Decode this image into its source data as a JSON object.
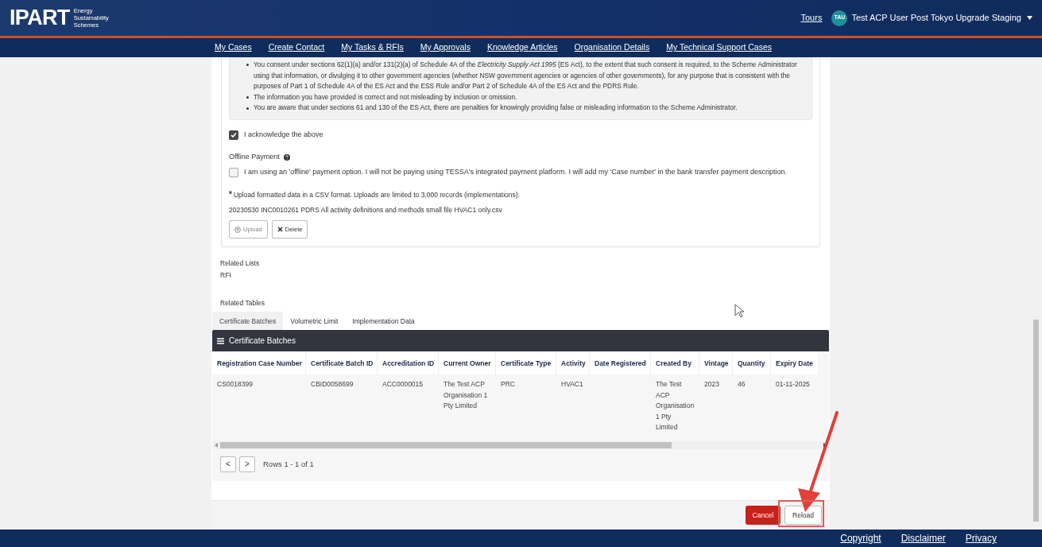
{
  "header": {
    "logo": "IPART",
    "logo_subtitle": [
      "Energy",
      "Sustainability",
      "Schemes"
    ],
    "tours_link": "Tours",
    "user_initials": "TAU",
    "user_name": "Test ACP User Post Tokyo Upgrade Staging"
  },
  "nav": [
    "My Cases",
    "Create Contact",
    "My Tasks & RFIs",
    "My Approvals",
    "Knowledge Articles",
    "Organisation Details",
    "My Technical Support Cases"
  ],
  "declarations": [
    {
      "text": "You consent under sections 62(1)(a) and/or 131(2)(a) of Schedule 4A of the *Electricity Supply Act 1995* (ES Act), to the extent that such consent is required, to the Scheme Administrator using that information, or divulging it to other government agencies (whether NSW government agencies or agencies of other governments), for any purpose that is consistent with the purposes of Part 1 of Schedule 4A of the ES Act and the ESS Rule and/or Part 2 of Schedule 4A of the ES Act and the PDRS Rule."
    },
    {
      "text": "The information you have provided is correct and not misleading by inclusion or omission."
    },
    {
      "text": "You are aware that under sections 61 and 130 of the ES Act, there are penalties for knowingly providing false or misleading information to the Scheme Administrator."
    }
  ],
  "acknowledge": {
    "label": "I acknowledge the above",
    "checked": true
  },
  "offline_payment": {
    "title": "Offline Payment",
    "label": "I am using an 'offline' payment option. I will not be paying using TESSA's integrated payment platform. I will add my 'Case number' in the bank transfer payment description.",
    "checked": false
  },
  "upload": {
    "required_mark": "*",
    "instructions": "Upload formatted data in a CSV format. Uploads are limited to 3,000 records (implementations).",
    "file_name": "20230530 INC0010261 PDRS All activity definitions and methods small file HVAC1 only.csv",
    "buttons": [
      "Upload",
      "Delete"
    ]
  },
  "related_lists": {
    "title": "Related Lists",
    "items": [
      "RFI"
    ]
  },
  "related_tables": {
    "title": "Related Tables",
    "tabs": [
      {
        "label": "Certificate Batches",
        "selected": true
      },
      {
        "label": "Volumetric Limit",
        "selected": false
      },
      {
        "label": "Implementation Data",
        "selected": false
      }
    ]
  },
  "table": {
    "title": "Certificate Batches",
    "columns": [
      "Registration Case Number",
      "Certificate Batch ID",
      "Accreditation ID",
      "Current Owner",
      "Certificate Type",
      "Activity",
      "Date Registered",
      "Created By",
      "Vintage",
      "Quantity",
      "Expiry Date"
    ],
    "rows": [
      [
        "CS0018399",
        "CBID0058699",
        "ACC0000015",
        "The Test ACP Organisation 1 Pty Limited",
        "PRC",
        "HVAC1",
        "",
        "The Test ACP Organisation 1 Pty Limited",
        "2023",
        "46",
        "01-11-2025"
      ]
    ],
    "pagination": {
      "prev": "<",
      "next": ">",
      "summary": "Rows 1 - 1 of 1"
    }
  },
  "actions": [
    "Cancel",
    "Reload"
  ],
  "footer": [
    "Copyright",
    "Disclaimer",
    "Privacy"
  ]
}
